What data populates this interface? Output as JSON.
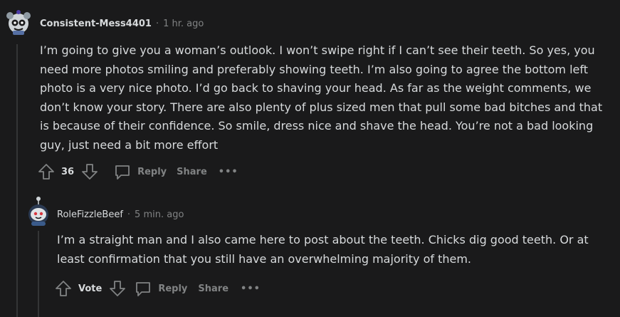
{
  "comments": [
    {
      "username": "Consistent-Mess4401",
      "time": "1 hr. ago",
      "body": "I’m going to give you a woman’s outlook. I won’t swipe right if I can’t see their teeth. So yes, you need more photos smiling and preferably showing teeth. I’m also going to agree the bottom left photo is a very nice photo. I’d go back to shaving your head. As far as the weight comments, we don’t know your story. There are also plenty of plus sized men that pull some bad bitches and that is because of their confidence. So smile, dress nice and shave the head. You’re not a bad looking guy, just need a bit more effort",
      "votes": "36",
      "reply_label": "Reply",
      "share_label": "Share",
      "more_label": "•••"
    },
    {
      "username": "RoleFizzleBeef",
      "time": "5 min. ago",
      "body": "I’m a straight man and I also came here to post about the teeth. Chicks dig good teeth. Or at least confirmation that you still have an overwhelming majority of them.",
      "votes": "Vote",
      "reply_label": "Reply",
      "share_label": "Share",
      "more_label": "•••"
    }
  ],
  "separator": "·",
  "colors": {
    "background": "#1a1a1b",
    "text": "#d7dadc",
    "meta": "#818384",
    "thread_line": "#343536"
  },
  "icons": {
    "upvote": "arrow-up-icon",
    "downvote": "arrow-down-icon",
    "reply": "comment-bubble-icon",
    "more": "ellipsis-icon"
  }
}
